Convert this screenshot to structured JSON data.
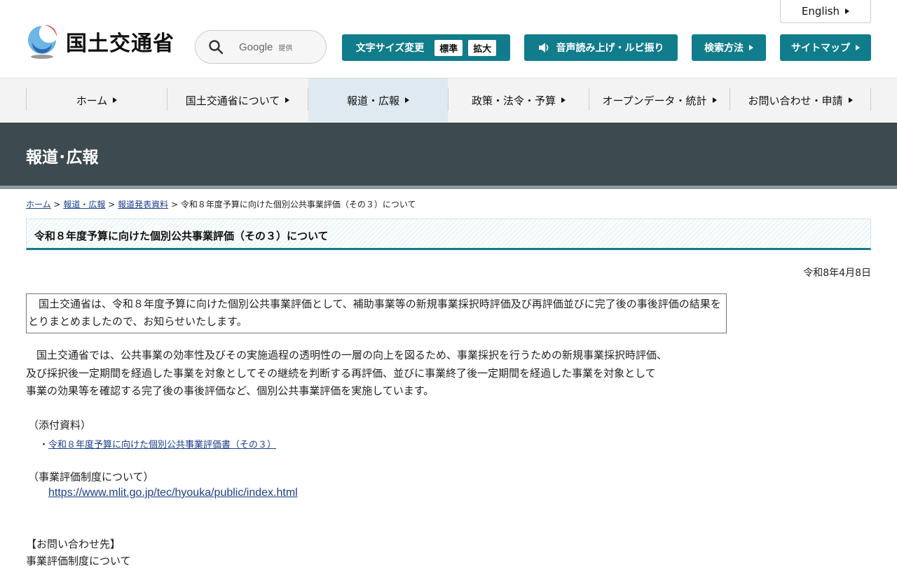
{
  "header": {
    "site_title": "国土交通省",
    "search": {
      "label": "Google",
      "sublabel": "提供"
    },
    "english": "English",
    "text_size": {
      "label": "文字サイズ変更",
      "standard": "標準",
      "large": "拡大"
    },
    "voice": "音声読み上げ・ルビ振り",
    "search_method": "検索方法",
    "sitemap": "サイトマップ",
    "colors": {
      "teal": "#117c8b",
      "banner": "#3d4a4f"
    }
  },
  "nav": {
    "items": [
      {
        "label": "ホーム"
      },
      {
        "label": "国土交通省について"
      },
      {
        "label": "報道・広報"
      },
      {
        "label": "政策・法令・予算"
      },
      {
        "label": "オープンデータ・統計"
      },
      {
        "label": "お問い合わせ・申請"
      }
    ],
    "active_index": 2
  },
  "banner": {
    "title": "報道･広報"
  },
  "breadcrumb": {
    "home": "ホーム",
    "press": "報道・広報",
    "releases": "報道発表資料",
    "current": "令和８年度予算に向けた個別公共事業評価（その３）について",
    "separator": ">"
  },
  "article": {
    "title": "令和８年度予算に向けた個別公共事業評価（その３）について",
    "date": "令和8年4月8日",
    "summary": "　国土交通省は、令和８年度予算に向けた個別公共事業評価として、補助事業等の新規事業採択時評価及び再評価並びに完了後の事後評価の結果をとりまとめましたので、お知らせいたします。",
    "body_lines": [
      "　国土交通省では、公共事業の効率性及びその実施過程の透明性の一層の向上を図るため、事業採択を行うための新規事業採択時評価、",
      "及び採択後一定期間を経過した事業を対象としてその継続を判断する再評価、並びに事業終了後一定期間を経過した事業を対象として",
      "事業の効果等を確認する完了後の事後評価など、個別公共事業評価を実施しています。"
    ],
    "attachments_label": "（添付資料）",
    "attachment_bullet": "・",
    "attachment_link": "令和８年度予算に向けた個別公共事業評価書（その３）",
    "system_label": "（事業評価制度について）",
    "system_url": "https://www.mlit.go.jp/tec/hyouka/public/index.html",
    "contact_label": "【お問い合わせ先】",
    "contact_first": "事業評価制度について"
  }
}
